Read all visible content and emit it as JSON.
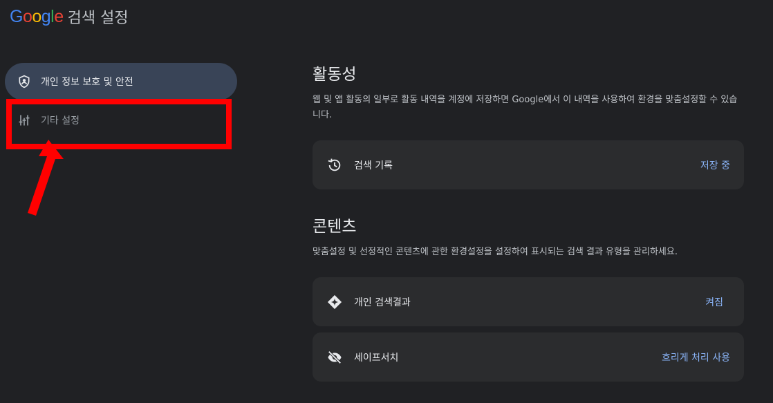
{
  "header": {
    "logo_letters": [
      {
        "char": "G",
        "color": "#4285f4"
      },
      {
        "char": "o",
        "color": "#ea4335"
      },
      {
        "char": "o",
        "color": "#fbbc05"
      },
      {
        "char": "g",
        "color": "#4285f4"
      },
      {
        "char": "l",
        "color": "#34a853"
      },
      {
        "char": "e",
        "color": "#ea4335"
      }
    ],
    "title": "검색 설정"
  },
  "sidebar": {
    "items": [
      {
        "label": "개인 정보 보호 및 안전",
        "icon": "shield-person-icon",
        "active": true
      },
      {
        "label": "기타 설정",
        "icon": "tune-sliders-icon",
        "active": false
      }
    ]
  },
  "sections": [
    {
      "title": "활동성",
      "description": "웹 및 앱 활동의 일부로 활동 내역을 계정에 저장하면 Google에서 이 내역을 사용하여 환경을 맞춤설정할 수 있습니다.",
      "cards": [
        {
          "label": "검색 기록",
          "value": "저장 중",
          "icon": "history-icon"
        }
      ]
    },
    {
      "title": "콘텐츠",
      "description": "맞춤설정 및 선정적인 콘텐츠에 관한 환경설정을 설정하여 표시되는 검색 결과 유형을 관리하세요.",
      "cards": [
        {
          "label": "개인 검색결과",
          "value": "켜짐",
          "icon": "sparkle-diamond-icon"
        },
        {
          "label": "세이프서치",
          "value": "흐리게 처리 사용",
          "icon": "visibility-off-icon"
        }
      ]
    }
  ],
  "colors": {
    "background": "#202124",
    "active_nav": "#394457",
    "card": "#2b2c2e",
    "link": "#8ab4f8",
    "annotation": "#ff0000"
  }
}
